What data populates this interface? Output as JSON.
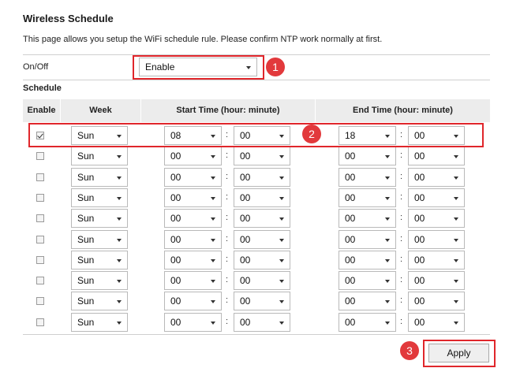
{
  "page": {
    "title": "Wireless Schedule",
    "description": "This page allows you setup the WiFi schedule rule. Please confirm NTP work normally at first."
  },
  "onoff": {
    "label": "On/Off",
    "value": "Enable"
  },
  "schedule": {
    "label": "Schedule",
    "headers": {
      "enable": "Enable",
      "week": "Week",
      "start": "Start Time (hour: minute)",
      "end": "End Time (hour: minute)"
    },
    "separator": ":",
    "rows": [
      {
        "enabled": true,
        "week": "Sun",
        "start_hour": "08",
        "start_min": "00",
        "end_hour": "18",
        "end_min": "00"
      },
      {
        "enabled": false,
        "week": "Sun",
        "start_hour": "00",
        "start_min": "00",
        "end_hour": "00",
        "end_min": "00"
      },
      {
        "enabled": false,
        "week": "Sun",
        "start_hour": "00",
        "start_min": "00",
        "end_hour": "00",
        "end_min": "00"
      },
      {
        "enabled": false,
        "week": "Sun",
        "start_hour": "00",
        "start_min": "00",
        "end_hour": "00",
        "end_min": "00"
      },
      {
        "enabled": false,
        "week": "Sun",
        "start_hour": "00",
        "start_min": "00",
        "end_hour": "00",
        "end_min": "00"
      },
      {
        "enabled": false,
        "week": "Sun",
        "start_hour": "00",
        "start_min": "00",
        "end_hour": "00",
        "end_min": "00"
      },
      {
        "enabled": false,
        "week": "Sun",
        "start_hour": "00",
        "start_min": "00",
        "end_hour": "00",
        "end_min": "00"
      },
      {
        "enabled": false,
        "week": "Sun",
        "start_hour": "00",
        "start_min": "00",
        "end_hour": "00",
        "end_min": "00"
      },
      {
        "enabled": false,
        "week": "Sun",
        "start_hour": "00",
        "start_min": "00",
        "end_hour": "00",
        "end_min": "00"
      },
      {
        "enabled": false,
        "week": "Sun",
        "start_hour": "00",
        "start_min": "00",
        "end_hour": "00",
        "end_min": "00"
      }
    ]
  },
  "apply_label": "Apply",
  "callouts": [
    "1",
    "2",
    "3"
  ],
  "colors": {
    "callout": "#e0262b",
    "badge": "#e2393c",
    "header_bg": "#ececec"
  }
}
